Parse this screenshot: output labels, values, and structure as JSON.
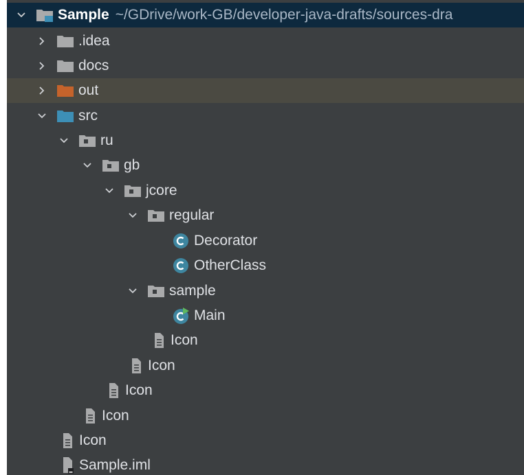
{
  "project": {
    "name": "Sample",
    "path": "~/GDrive/work-GB/developer-java-drafts/sources-dra"
  },
  "tree": {
    "idea": ".idea",
    "docs": "docs",
    "out": "out",
    "src": "src",
    "ru": "ru",
    "gb": "gb",
    "jcore": "jcore",
    "regular": "regular",
    "decorator": "Decorator",
    "other_class": "OtherClass",
    "sample": "sample",
    "main": "Main",
    "icon_sample": "Icon",
    "icon_jcore": "Icon",
    "icon_gb": "Icon",
    "icon_ru": "Icon",
    "icon_src": "Icon",
    "sample_iml": "Sample.iml"
  },
  "colors": {
    "panel_bg": "#3c3f41",
    "root_row_bg": "#0d293e",
    "highlight_row_bg": "#4b4a42",
    "folder_gray": "#a9aaab",
    "folder_orange": "#c5632b",
    "folder_blue": "#3d8fb6",
    "class_badge": "#3e86a0",
    "run_arrow": "#5fb85f"
  }
}
